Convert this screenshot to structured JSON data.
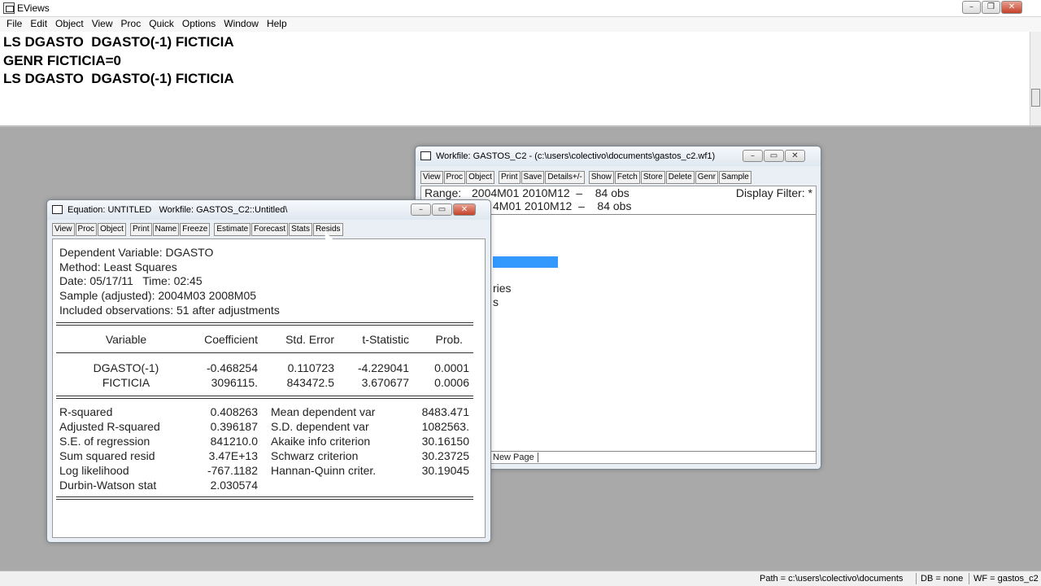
{
  "app": {
    "title": "EViews"
  },
  "menu": [
    "File",
    "Edit",
    "Object",
    "View",
    "Proc",
    "Quick",
    "Options",
    "Window",
    "Help"
  ],
  "command_lines": [
    "LS DGASTO  DGASTO(-1) FICTICIA",
    "GENR FICTICIA=0",
    "LS DGASTO  DGASTO(-1) FICTICIA"
  ],
  "workfile_window": {
    "title": "Workfile: GASTOS_C2 - (c:\\users\\colectivo\\documents\\gastos_c2.wf1)",
    "toolbar": [
      "View",
      "Proc",
      "Object",
      "Print",
      "Save",
      "Details+/-",
      "Show",
      "Fetch",
      "Store",
      "Delete",
      "Genr",
      "Sample"
    ],
    "range_label": "Range:",
    "range_value": "2004M01 2010M12  –    84 obs",
    "display_filter": "Display Filter: *",
    "sample_value": "4M01 2010M12  –    84 obs",
    "partial_text_1": "ries",
    "partial_text_2": "s",
    "tab_label": "New Page"
  },
  "equation_window": {
    "title": "Equation: UNTITLED   Workfile: GASTOS_C2::Untitled\\",
    "toolbar": [
      "View",
      "Proc",
      "Object",
      "Print",
      "Name",
      "Freeze",
      "Estimate",
      "Forecast",
      "Stats",
      "Resids"
    ],
    "header": [
      "Dependent Variable: DGASTO",
      "Method: Least Squares",
      "Date: 05/17/11   Time: 02:45",
      "Sample (adjusted): 2004M03 2008M05",
      "Included observations: 51 after adjustments"
    ],
    "columns": [
      "Variable",
      "Coefficient",
      "Std. Error",
      "t-Statistic",
      "Prob."
    ],
    "rows": [
      [
        "DGASTO(-1)",
        "-0.468254",
        "0.110723",
        "-4.229041",
        "0.0001"
      ],
      [
        "FICTICIA",
        "3096115.",
        "843472.5",
        "3.670677",
        "0.0006"
      ]
    ],
    "stats": [
      [
        "R-squared",
        "0.408263",
        "Mean dependent var",
        "8483.471"
      ],
      [
        "Adjusted R-squared",
        "0.396187",
        "S.D. dependent var",
        "1082563."
      ],
      [
        "S.E. of regression",
        "841210.0",
        "Akaike info criterion",
        "30.16150"
      ],
      [
        "Sum squared resid",
        "3.47E+13",
        "Schwarz criterion",
        "30.23725"
      ],
      [
        "Log likelihood",
        "-767.1182",
        "Hannan-Quinn criter.",
        "30.19045"
      ],
      [
        "Durbin-Watson stat",
        "2.030574",
        "",
        ""
      ]
    ]
  },
  "status": {
    "path": "Path = c:\\users\\colectivo\\documents",
    "db": "DB = none",
    "wf": "WF = gastos_c2"
  },
  "colors": {
    "selection": "#3399ff",
    "desktop": "#a9a9a9"
  }
}
